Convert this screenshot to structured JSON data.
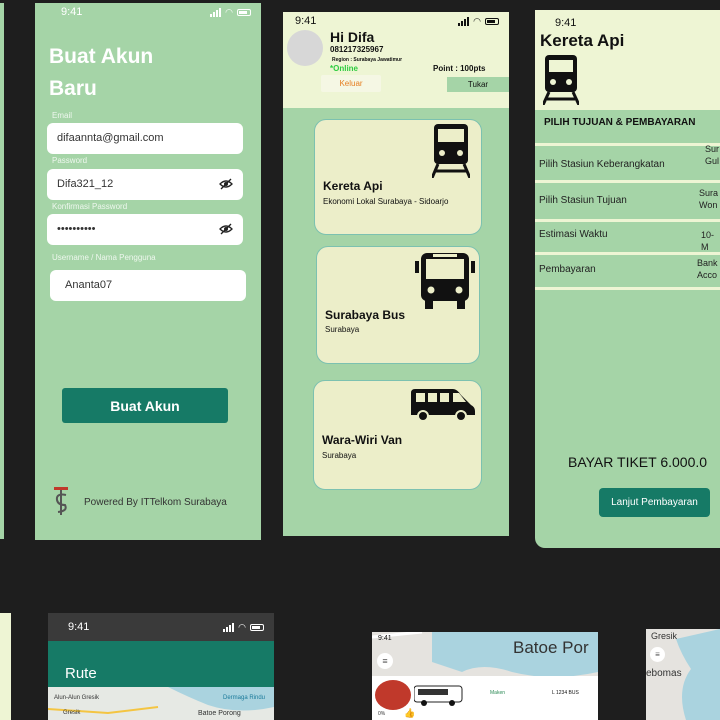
{
  "left_edge": {
    "time": ""
  },
  "signup": {
    "time": "9:41",
    "title_line1": "Buat Akun",
    "title_line2": "Baru",
    "email_label": "Email",
    "email_value": "difaannta@gmail.com",
    "password_label": "Password",
    "password_value": "Difa321_12",
    "confirm_label": "Konfirmasi Password",
    "confirm_value": "••••••••••",
    "username_label": "Username / Nama Pengguna",
    "username_value": "Ananta07",
    "submit_label": "Buat Akun",
    "footer": "Powered By ITTelkom Surabaya",
    "colors": {
      "bg": "#a5d4a7",
      "button": "#167a66"
    }
  },
  "home": {
    "time": "9:41",
    "greeting": "Hi Difa",
    "phone": "081217325967",
    "region": "Region : Surabaya Jawatimur",
    "status": "*Online",
    "points": "Point : 100pts",
    "logout_label": "Keluar",
    "exchange_label": "Tukar",
    "cards": [
      {
        "title": "Kereta Api",
        "subtitle": "Ekonomi Lokal Surabaya - Sidoarjo",
        "icon": "train-icon"
      },
      {
        "title": "Surabaya Bus",
        "subtitle": "Surabaya",
        "icon": "bus-icon"
      },
      {
        "title": "Wara-Wiri Van",
        "subtitle": "Surabaya",
        "icon": "van-icon"
      }
    ]
  },
  "train": {
    "time": "9:41",
    "title": "Kereta Api",
    "section_title": "PILIH TUJUAN & PEMBAYARAN",
    "rows": [
      {
        "label": "Pilih Stasiun Keberangkatan",
        "value_line1": "Sur",
        "value_line2": "Gul"
      },
      {
        "label": "Pilih Stasiun Tujuan",
        "value_line1": "Sura",
        "value_line2": "Won"
      },
      {
        "label": "Estimasi Waktu",
        "value_line1": "10-M",
        "value_line2": ""
      },
      {
        "label": "Pembayaran",
        "value_line1": "Bank",
        "value_line2": "Acco"
      }
    ],
    "total": "BAYAR TIKET 6.000.0",
    "continue_label": "Lanjut Pembayaran"
  },
  "route": {
    "time": "9:41",
    "title": "Rute",
    "map_labels": [
      "Alun-Alun Gresik",
      "Dermaga Rindu",
      "Gresik",
      "Batoe Porong"
    ]
  },
  "mapview": {
    "time": "9:41",
    "place": "Batoe Por",
    "driver_status": "Maken",
    "plate": "L 1234 BUS",
    "percent": "0%"
  },
  "mapview2": {
    "labels": [
      "Gresik",
      "ebomas"
    ]
  }
}
